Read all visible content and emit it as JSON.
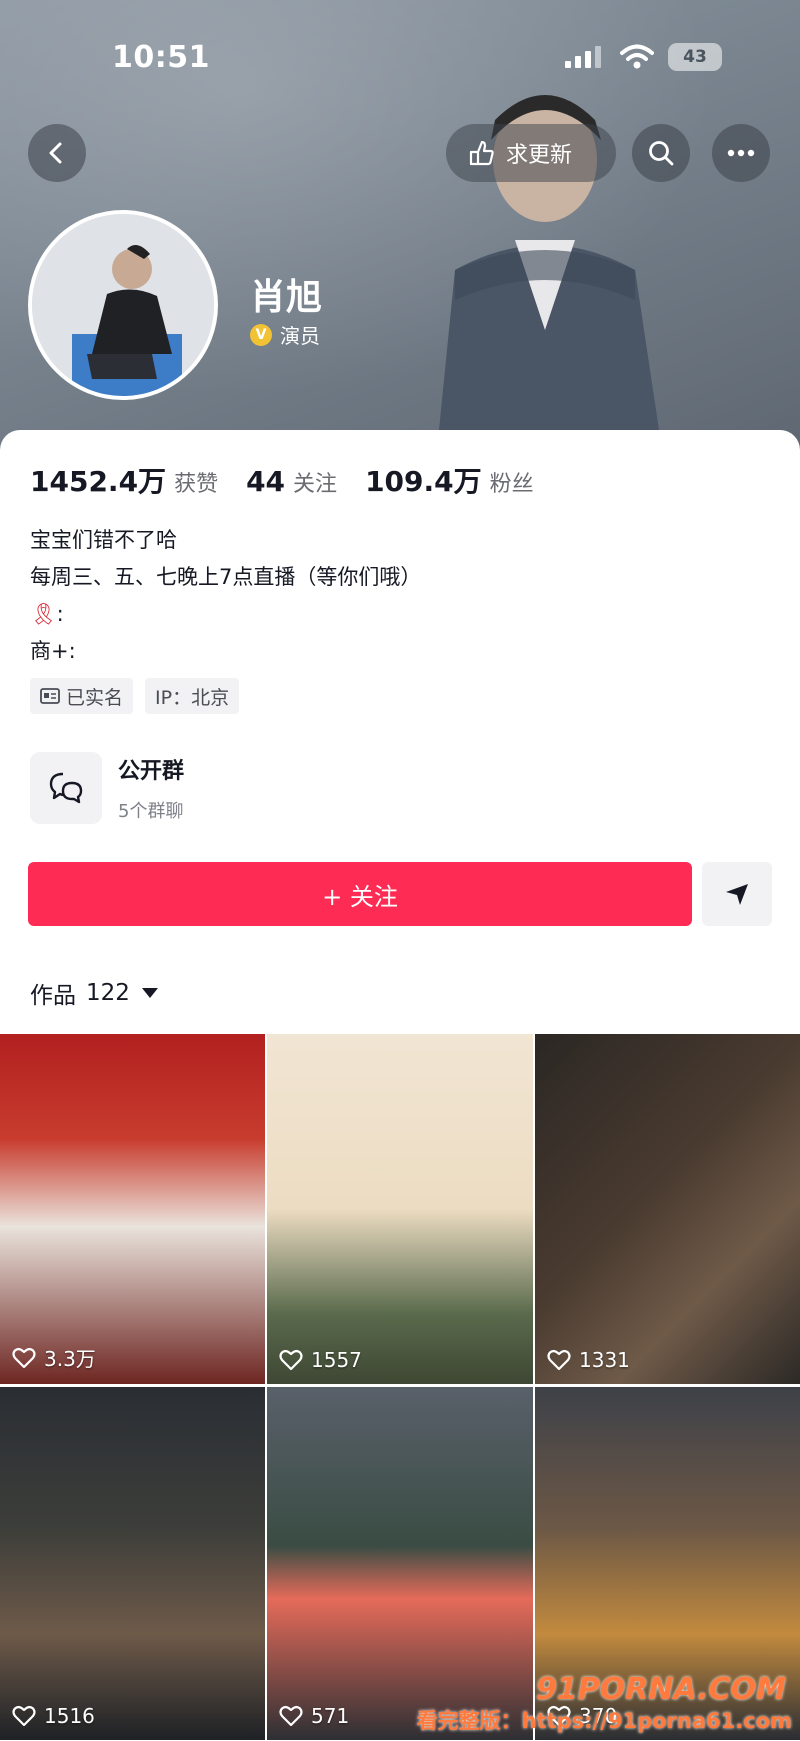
{
  "status_bar": {
    "time": "10:51",
    "battery": "43"
  },
  "header": {
    "update_label": "求更新",
    "name": "肖旭",
    "role": "演员"
  },
  "stats": [
    {
      "value": "1452.4万",
      "label": "获赞"
    },
    {
      "value": "44",
      "label": "关注"
    },
    {
      "value": "109.4万",
      "label": "粉丝"
    }
  ],
  "bio": {
    "line1": "宝宝们错不了哈",
    "line2": "每周三、五、七晚上7点直播（等你们哦）",
    "line3": ":",
    "line4": "商+:"
  },
  "tags": {
    "verified": "已实名",
    "ip": "IP：北京"
  },
  "group": {
    "title": "公开群",
    "subtitle": "5个群聊"
  },
  "follow_label": "+ 关注",
  "works": {
    "label": "作品",
    "count": "122"
  },
  "videos": [
    {
      "likes": "3.3万"
    },
    {
      "likes": "1557"
    },
    {
      "likes": "1331"
    },
    {
      "likes": "1516"
    },
    {
      "likes": "571"
    },
    {
      "likes": "370"
    }
  ],
  "watermark": {
    "logo": "91PORNA.COM",
    "url": "看完整版：https://91porna61.com"
  },
  "colors": {
    "accent": "#fe2c55",
    "verified_badge": "#f0c234"
  }
}
